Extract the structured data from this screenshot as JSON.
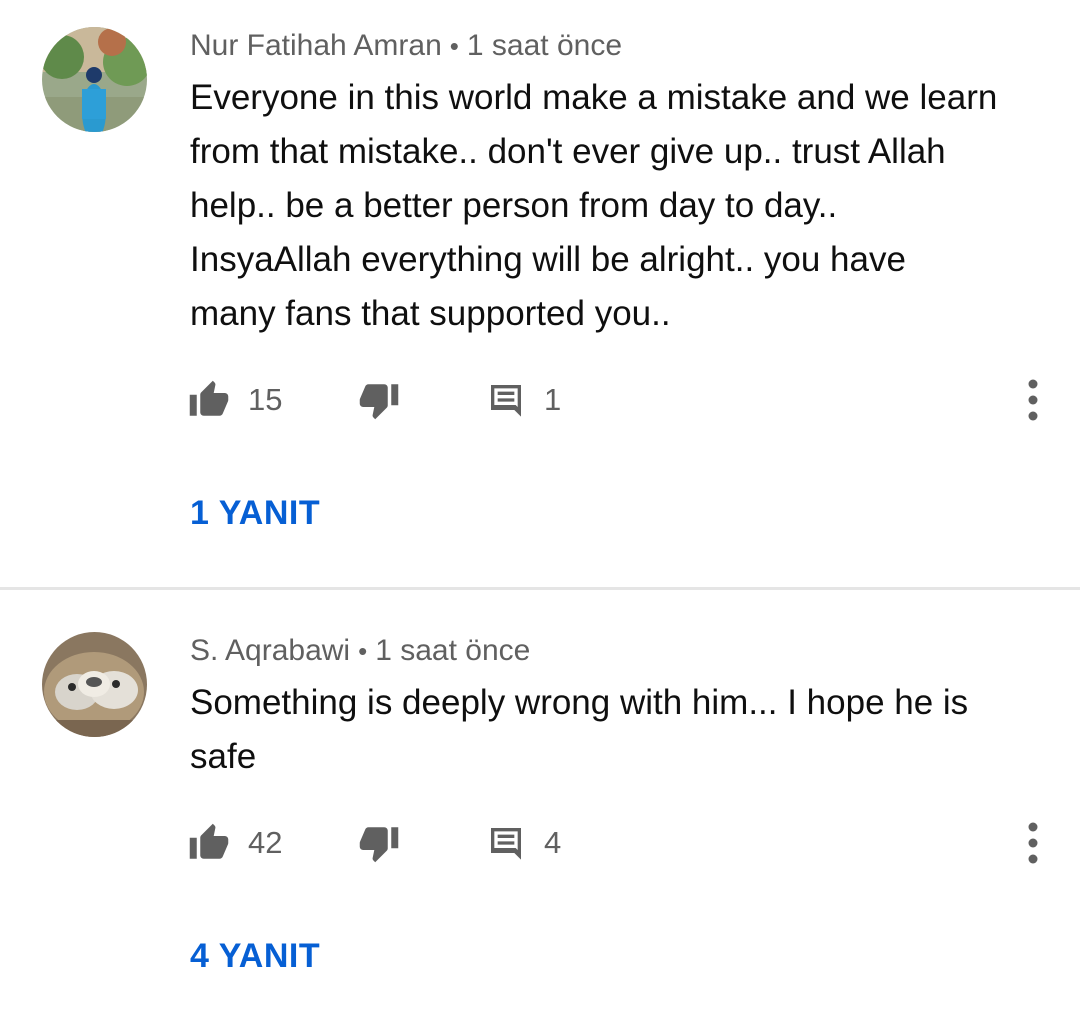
{
  "comments": [
    {
      "author": "Nur Fatihah Amran",
      "separator": "•",
      "time": "1 saat önce",
      "text": "Everyone in this world make a mistake and we learn\nfrom that mistake.. don't ever give up.. trust Allah\nhelp.. be a better person from day to day..\nInsyaAllah everything will be alright.. you have\nmany fans that supported you..",
      "likes": "15",
      "replies_count": "1",
      "replies_label": "1 YANIT"
    },
    {
      "author": "S. Aqrabawi",
      "separator": "•",
      "time": "1 saat önce",
      "text": "Something is deeply wrong with him... I hope he is\nsafe",
      "likes": "42",
      "replies_count": "4",
      "replies_label": "4 YANIT"
    }
  ],
  "icons": {
    "like": "thumb-up-icon",
    "dislike": "thumb-down-icon",
    "reply": "comment-icon",
    "more": "more-vert-icon"
  },
  "colors": {
    "link": "#065fd4",
    "secondary_text": "#606060",
    "icon": "#606060",
    "divider": "#e5e5e5"
  }
}
